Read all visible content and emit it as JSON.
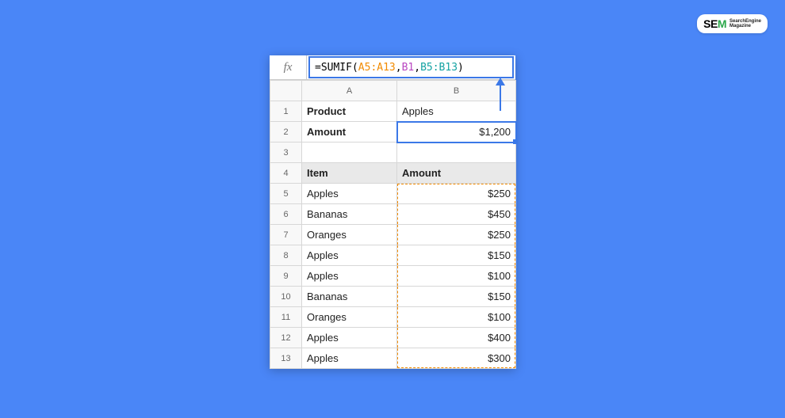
{
  "logo": {
    "se": "SE",
    "m": "M",
    "line1": "SearchEngine",
    "line2": "Magazine"
  },
  "formula": {
    "eq": "=",
    "fn": "SUMIF",
    "open": "(",
    "r1": "A5:A13",
    "c1": ",",
    "r2": "B1",
    "c2": ",",
    "r3": "B5:B13",
    "close": ")"
  },
  "columns": {
    "A": "A",
    "B": "B"
  },
  "rows": {
    "1": {
      "num": "1",
      "A": "Product",
      "B": "Apples"
    },
    "2": {
      "num": "2",
      "A": "Amount",
      "B": "$1,200"
    },
    "3": {
      "num": "3",
      "A": "",
      "B": ""
    },
    "4": {
      "num": "4",
      "A": "Item",
      "B": "Amount"
    },
    "5": {
      "num": "5",
      "A": "Apples",
      "B": "$250"
    },
    "6": {
      "num": "6",
      "A": "Bananas",
      "B": "$450"
    },
    "7": {
      "num": "7",
      "A": "Oranges",
      "B": "$250"
    },
    "8": {
      "num": "8",
      "A": "Apples",
      "B": "$150"
    },
    "9": {
      "num": "9",
      "A": "Apples",
      "B": "$100"
    },
    "10": {
      "num": "10",
      "A": "Bananas",
      "B": "$150"
    },
    "11": {
      "num": "11",
      "A": "Oranges",
      "B": "$100"
    },
    "12": {
      "num": "12",
      "A": "Apples",
      "B": "$400"
    },
    "13": {
      "num": "13",
      "A": "Apples",
      "B": "$300"
    }
  }
}
